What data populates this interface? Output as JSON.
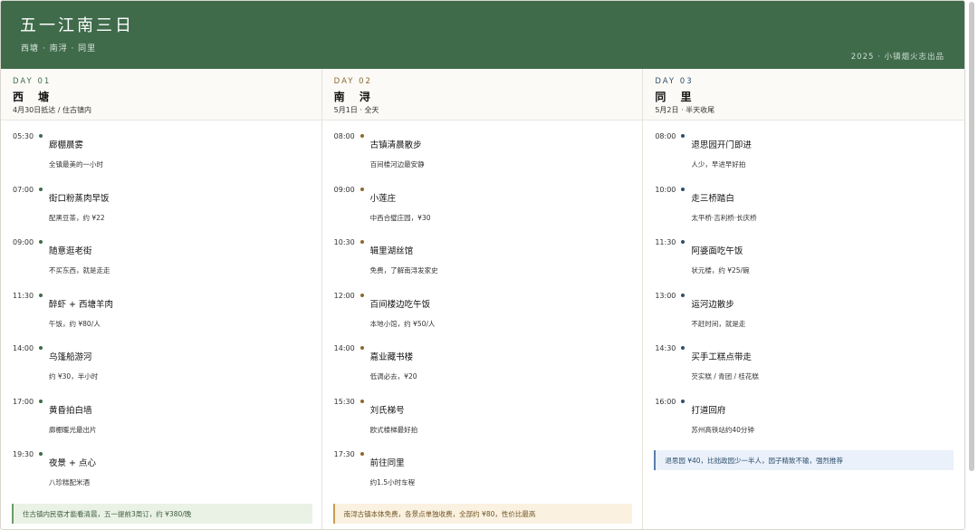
{
  "header": {
    "title": "五一江南三日",
    "subtitle": "西塘 · 南浔 · 同里",
    "credit": "2025 · 小镇烟火志出品"
  },
  "colors": {
    "header_bg": "#3f6b4b",
    "day1_accent": "#3f6b4b",
    "day2_accent": "#8a6a2c",
    "day3_accent": "#2f4f6b"
  },
  "days": [
    {
      "num": "DAY 01",
      "name": "西 塘",
      "note": "4月30日抵达 / 住古镇内",
      "events": [
        {
          "time": "05:30",
          "name": "廊棚晨雾",
          "desc": "全镇最美的一小时"
        },
        {
          "time": "07:00",
          "name": "街口粉蒸肉早饭",
          "desc": "配黑豆茶，约 ¥22"
        },
        {
          "time": "09:00",
          "name": "随意逛老街",
          "desc": "不买东西，就是走走"
        },
        {
          "time": "11:30",
          "name": "醉虾 + 西塘羊肉",
          "desc": "午饭，约 ¥80/人"
        },
        {
          "time": "14:00",
          "name": "乌篷船游河",
          "desc": "约 ¥30，半小时"
        },
        {
          "time": "17:00",
          "name": "黄昏拍白墙",
          "desc": "廊棚暖光最出片"
        },
        {
          "time": "19:30",
          "name": "夜景 + 点心",
          "desc": "八珍糕配米酒"
        }
      ],
      "footnote": "住古镇内民宿才能看清晨，五一提前3周订，约 ¥380/晚"
    },
    {
      "num": "DAY 02",
      "name": "南 浔",
      "note": "5月1日 · 全天",
      "events": [
        {
          "time": "08:00",
          "name": "古镇清晨散步",
          "desc": "百间楼河边最安静"
        },
        {
          "time": "09:00",
          "name": "小莲庄",
          "desc": "中西合璧庄园，¥30"
        },
        {
          "time": "10:30",
          "name": "辑里湖丝馆",
          "desc": "免费，了解南浔发家史"
        },
        {
          "time": "12:00",
          "name": "百间楼边吃午饭",
          "desc": "本地小馆，约 ¥50/人"
        },
        {
          "time": "14:00",
          "name": "嘉业藏书楼",
          "desc": "低调必去，¥20"
        },
        {
          "time": "15:30",
          "name": "刘氏梯号",
          "desc": "欧式楼梯最好拍"
        },
        {
          "time": "17:30",
          "name": "前往同里",
          "desc": "约1.5小时车程"
        }
      ],
      "footnote": "南浔古镇本体免费，各景点单独收费，全部约 ¥80，性价比最高"
    },
    {
      "num": "DAY 03",
      "name": "同 里",
      "note": "5月2日 · 半天收尾",
      "events": [
        {
          "time": "08:00",
          "name": "退思园开门即进",
          "desc": "人少，早进早好拍"
        },
        {
          "time": "10:00",
          "name": "走三桥踏白",
          "desc": "太平桥·吉利桥·长庆桥"
        },
        {
          "time": "11:30",
          "name": "阿婆面吃午饭",
          "desc": "状元楼，约 ¥25/碗"
        },
        {
          "time": "13:00",
          "name": "运河边散步",
          "desc": "不赶时间，就是走"
        },
        {
          "time": "14:30",
          "name": "买手工糕点带走",
          "desc": "芡实糕 / 青团 / 桂花糕"
        },
        {
          "time": "16:00",
          "name": "打道回府",
          "desc": "苏州高铁站约40分钟"
        }
      ],
      "footnote": "退思园 ¥40，比拙政园少一半人，园子精致不输，强烈推荐"
    }
  ]
}
